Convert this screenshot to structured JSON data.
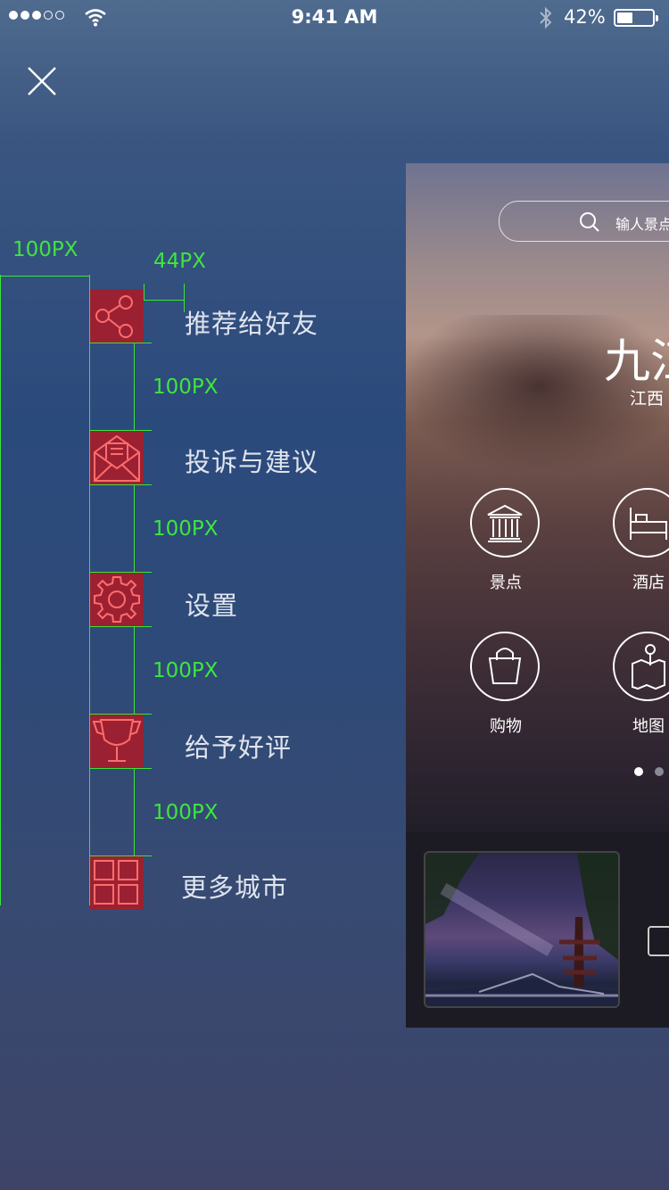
{
  "status_bar": {
    "time": "9:41 AM",
    "battery_percent": "42%",
    "battery_level": 0.42,
    "signal_bars_filled": 3,
    "signal_bars_total": 5
  },
  "menu": {
    "items": [
      {
        "label": "推荐给好友",
        "icon": "share-icon"
      },
      {
        "label": "投诉与建议",
        "icon": "envelope-icon"
      },
      {
        "label": "设置",
        "icon": "gear-icon"
      },
      {
        "label": "给予好评",
        "icon": "trophy-icon"
      },
      {
        "label": "更多城市",
        "icon": "grid-icon"
      }
    ]
  },
  "annotations": {
    "left_width": "100PX",
    "icon_gap": "44PX",
    "spacing_1": "100PX",
    "spacing_2": "100PX",
    "spacing_3": "100PX",
    "spacing_4": "100PX"
  },
  "guide_color": "#39e339",
  "icon_bg_color": "#9b2132",
  "preview": {
    "search_placeholder": "输人景点",
    "city": "九江",
    "province": "江西",
    "categories": [
      {
        "label": "景点",
        "icon": "museum-icon"
      },
      {
        "label": "酒店",
        "icon": "bed-icon"
      },
      {
        "label": "购物",
        "icon": "shopping-bag-icon"
      },
      {
        "label": "地图",
        "icon": "map-icon"
      }
    ],
    "carousel_pages": 2,
    "carousel_active": 1
  }
}
